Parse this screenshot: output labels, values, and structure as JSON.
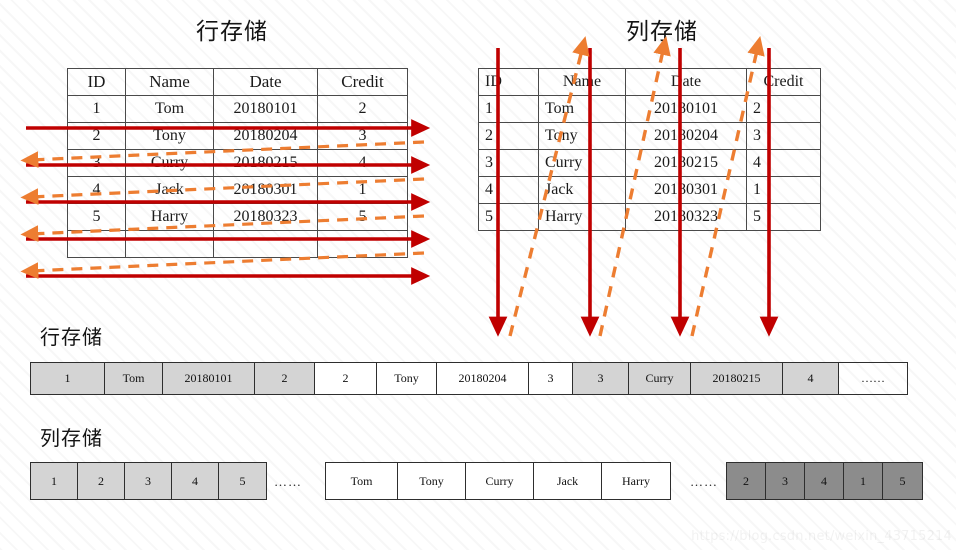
{
  "page": {
    "watermark": "https://blog.csdn.net/weixin_43715214",
    "colors": {
      "red_arrow": "#c00000",
      "orange_arrow": "#ed7d31",
      "cell_gray": "#d4d4d4",
      "cell_dark_gray": "#8c8c8c",
      "border": "#2e2e2e",
      "text": "#141414"
    }
  },
  "row_table": {
    "title": "行存储",
    "headers": [
      "ID",
      "Name",
      "Date",
      "Credit"
    ],
    "rows": [
      [
        "1",
        "Tom",
        "20180101",
        "2"
      ],
      [
        "2",
        "Tony",
        "20180204",
        "3"
      ],
      [
        "3",
        "Curry",
        "20180215",
        "4"
      ],
      [
        "4",
        "Jack",
        "20180301",
        "1"
      ],
      [
        "5",
        "Harry",
        "20180323",
        "5"
      ]
    ]
  },
  "col_table": {
    "title": "列存储",
    "headers": [
      "ID",
      "Name",
      "Date",
      "Credit",
      ""
    ],
    "rows": [
      [
        "1",
        "Tom",
        "20180101",
        "2",
        ""
      ],
      [
        "2",
        "Tony",
        "20180204",
        "3",
        ""
      ],
      [
        "3",
        "Curry",
        "20180215",
        "4",
        ""
      ],
      [
        "4",
        "Jack",
        "20180301",
        "1",
        ""
      ],
      [
        "5",
        "Harry",
        "20180323",
        "5",
        ""
      ]
    ]
  },
  "row_strip": {
    "title": "行存储",
    "cells": [
      {
        "text": "1",
        "style": "gray",
        "w": 74
      },
      {
        "text": "Tom",
        "style": "gray",
        "w": 58
      },
      {
        "text": "20180101",
        "style": "gray",
        "w": 92
      },
      {
        "text": "2",
        "style": "gray",
        "w": 60
      },
      {
        "text": "2",
        "style": "white",
        "w": 62
      },
      {
        "text": "Tony",
        "style": "white",
        "w": 60
      },
      {
        "text": "20180204",
        "style": "white",
        "w": 92
      },
      {
        "text": "3",
        "style": "white",
        "w": 44
      },
      {
        "text": "3",
        "style": "gray",
        "w": 56
      },
      {
        "text": "Curry",
        "style": "gray",
        "w": 62
      },
      {
        "text": "20180215",
        "style": "gray",
        "w": 92
      },
      {
        "text": "4",
        "style": "gray",
        "w": 56
      },
      {
        "text": "……",
        "style": "clear",
        "w": 68
      }
    ]
  },
  "col_strip": {
    "title": "列存储",
    "group_ids": {
      "cells": [
        {
          "text": "1",
          "style": "gray",
          "w": 47
        },
        {
          "text": "2",
          "style": "gray",
          "w": 47
        },
        {
          "text": "3",
          "style": "gray",
          "w": 47
        },
        {
          "text": "4",
          "style": "gray",
          "w": 47
        },
        {
          "text": "5",
          "style": "gray",
          "w": 47
        }
      ]
    },
    "ellipsis_1": "……",
    "group_names": {
      "cells": [
        {
          "text": "Tom",
          "style": "white",
          "w": 72
        },
        {
          "text": "Tony",
          "style": "white",
          "w": 68
        },
        {
          "text": "Curry",
          "style": "white",
          "w": 68
        },
        {
          "text": "Jack",
          "style": "white",
          "w": 68
        },
        {
          "text": "Harry",
          "style": "white",
          "w": 68
        }
      ]
    },
    "ellipsis_2": "……",
    "group_credits": {
      "cells": [
        {
          "text": "2",
          "style": "dgray",
          "w": 39
        },
        {
          "text": "3",
          "style": "dgray",
          "w": 39
        },
        {
          "text": "4",
          "style": "dgray",
          "w": 39
        },
        {
          "text": "1",
          "style": "dgray",
          "w": 39
        },
        {
          "text": "5",
          "style": "dgray",
          "w": 39
        }
      ]
    }
  }
}
